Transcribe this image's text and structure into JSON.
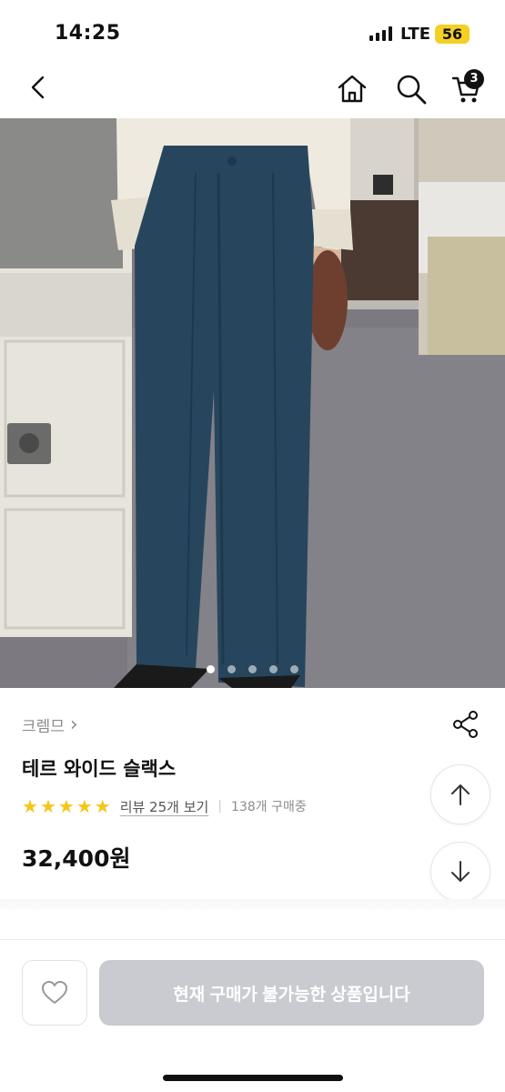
{
  "status_bar": {
    "time": "14:25",
    "network": "LTE",
    "battery": "56"
  },
  "nav": {
    "back_icon": "chevron-left-icon",
    "home_icon": "home-icon",
    "search_icon": "search-icon",
    "cart_icon": "cart-icon",
    "cart_count": "3"
  },
  "gallery": {
    "total_images": 5,
    "active_index": 0
  },
  "product": {
    "brand": "크렘므",
    "brand_chevron": "›",
    "name": "테르 와이드 슬랙스",
    "rating_stars": 5,
    "review_link": "리뷰 25개 보기",
    "separator": "|",
    "buyers": "138개 구매중",
    "price": "32,400원"
  },
  "bottom_bar": {
    "wish_icon": "heart-icon",
    "buy_label": "현재 구매가 불가능한 상품입니다"
  },
  "colors": {
    "accent_star": "#f5c518",
    "disabled_button": "#c9cbd1",
    "battery": "#f4cf25"
  }
}
